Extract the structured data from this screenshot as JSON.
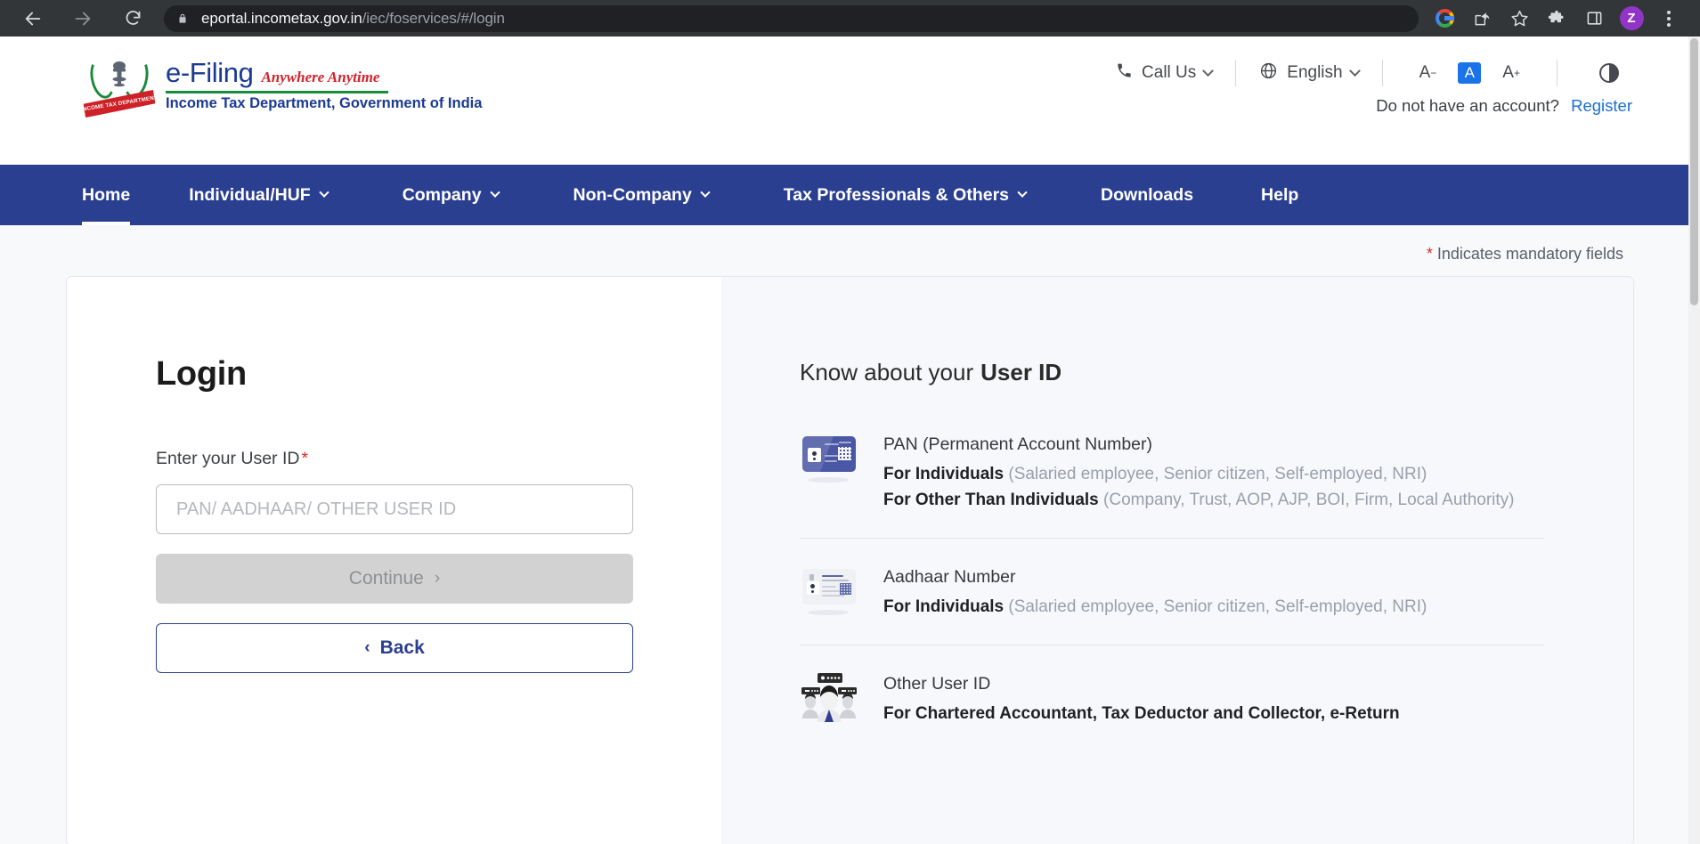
{
  "browser": {
    "url_host": "eportal.incometax.gov.in",
    "url_path": "/iec/foservices/#/login",
    "back_icon": "back-arrow-icon",
    "forward_icon": "forward-arrow-icon",
    "reload_icon": "reload-icon",
    "lock_icon": "lock-icon",
    "google_icon": "google-logo-icon",
    "share_icon": "share-icon",
    "bookmark_icon": "star-icon",
    "extensions_icon": "puzzle-icon",
    "sidepanel_icon": "side-panel-icon",
    "profile_initial": "Z",
    "menu_icon": "kebab-menu-icon"
  },
  "header": {
    "logo": {
      "brand": "e-Filing",
      "tagline": "Anywhere Anytime",
      "department": "Income Tax Department, Government of India",
      "ribbon_text": "INCOME TAX DEPARTMENT"
    },
    "call_us": "Call Us",
    "language": "English",
    "font_decrease": "A",
    "font_decrease_sup": "−",
    "font_normal": "A",
    "font_increase": "A",
    "font_increase_sup": "+",
    "contrast_label": "contrast-toggle",
    "account_prompt": "Do not have an account?",
    "register": "Register"
  },
  "nav": {
    "items": [
      {
        "label": "Home",
        "has_chevron": false,
        "active": true
      },
      {
        "label": "Individual/HUF",
        "has_chevron": true,
        "active": false
      },
      {
        "label": "Company",
        "has_chevron": true,
        "active": false
      },
      {
        "label": "Non-Company",
        "has_chevron": true,
        "active": false
      },
      {
        "label": "Tax Professionals & Others",
        "has_chevron": true,
        "active": false
      },
      {
        "label": "Downloads",
        "has_chevron": false,
        "active": false
      },
      {
        "label": "Help",
        "has_chevron": false,
        "active": false
      }
    ]
  },
  "main": {
    "mandatory_note": "Indicates mandatory fields",
    "mandatory_star": "*",
    "login": {
      "title": "Login",
      "user_id_label": "Enter your User ID",
      "user_id_required_star": "*",
      "user_id_value": "",
      "user_id_placeholder": "PAN/ AADHAAR/ OTHER USER ID",
      "continue_label": "Continue",
      "continue_arrow": "›",
      "back_label": "Back",
      "back_arrow": "‹"
    },
    "know_panel": {
      "title_normal": "Know about your",
      "title_bold": "User ID",
      "items": [
        {
          "icon": "pan-card-icon",
          "name": "PAN (Permanent Account Number)",
          "lines": [
            {
              "bold": "For Individuals",
              "normal": " (Salaried employee, Senior citizen, Self-employed, NRI)"
            },
            {
              "bold": "For Other Than Individuals",
              "normal": " (Company, Trust, AOP, AJP, BOI, Firm, Local Authority)"
            }
          ]
        },
        {
          "icon": "aadhaar-card-icon",
          "name": "Aadhaar Number",
          "lines": [
            {
              "bold": "For Individuals",
              "normal": " (Salaried employee, Senior citizen, Self-employed, NRI)"
            }
          ]
        },
        {
          "icon": "people-group-icon",
          "name": "Other User ID",
          "lines": [
            {
              "bold": "For Chartered Accountant, Tax Deductor and Collector, e-Return",
              "normal": ""
            }
          ]
        }
      ]
    }
  },
  "colors": {
    "nav_blue": "#2b3f91",
    "brand_blue": "#1b3a93",
    "brand_red": "#d0232b",
    "brand_green": "#1a8a3c",
    "link_blue": "#1a6fd4",
    "required_red": "#d93025",
    "accent_active": "#1a73e8"
  }
}
